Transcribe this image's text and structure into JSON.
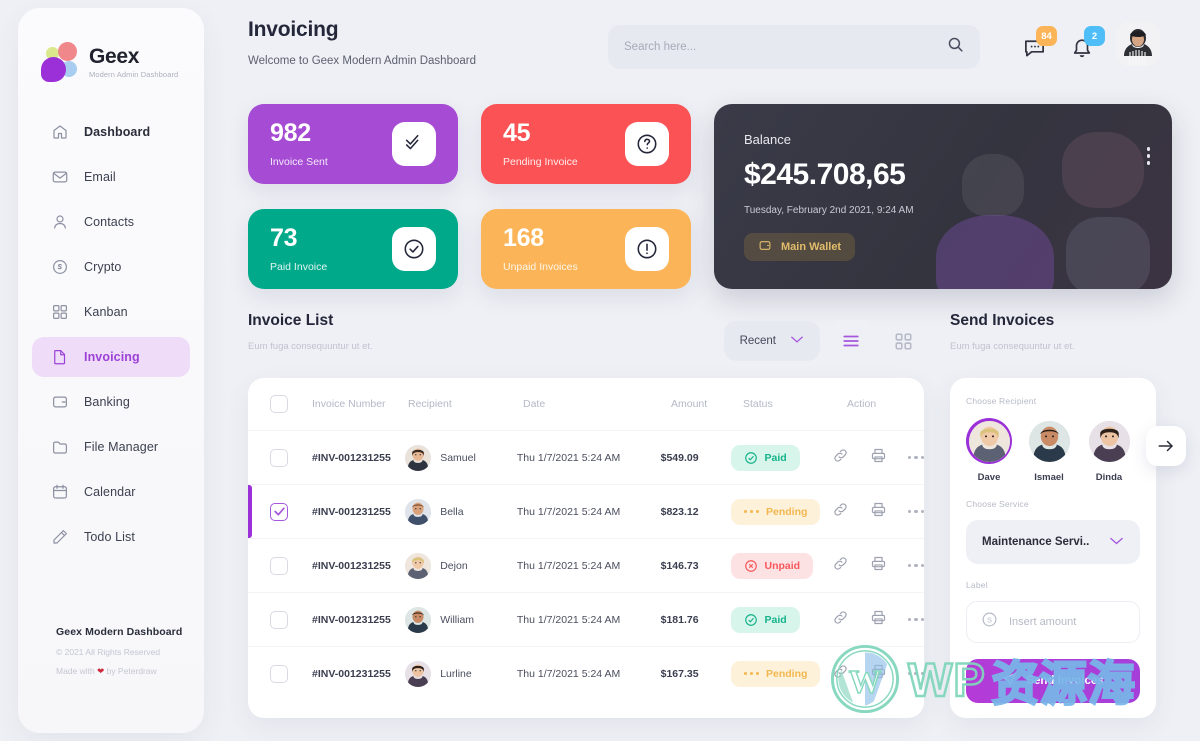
{
  "brand": {
    "name": "Geex",
    "subtitle": "Modern Admin Dashboard"
  },
  "sidebar": {
    "items": [
      {
        "label": "Dashboard",
        "icon": "home-icon",
        "active": false
      },
      {
        "label": "Email",
        "icon": "envelope-icon",
        "active": false
      },
      {
        "label": "Contacts",
        "icon": "user-icon",
        "active": false
      },
      {
        "label": "Crypto",
        "icon": "coin-icon",
        "active": false
      },
      {
        "label": "Kanban",
        "icon": "grid-icon",
        "active": false
      },
      {
        "label": "Invoicing",
        "icon": "file-icon",
        "active": true
      },
      {
        "label": "Banking",
        "icon": "wallet-icon",
        "active": false
      },
      {
        "label": "File Manager",
        "icon": "folder-icon",
        "active": false
      },
      {
        "label": "Calendar",
        "icon": "calendar-icon",
        "active": false
      },
      {
        "label": "Todo List",
        "icon": "pencil-icon",
        "active": false
      }
    ],
    "footer": {
      "title": "Geex Modern Dashboard",
      "copyright": "© 2021 All Rights Reserved",
      "made_prefix": "Made with ",
      "made_suffix": " by Peterdraw"
    }
  },
  "header": {
    "title": "Invoicing",
    "subtitle": "Welcome to Geex Modern Admin Dashboard",
    "search_placeholder": "Search here...",
    "search_value": "",
    "message_badge": "84",
    "notification_badge": "2"
  },
  "stats": [
    {
      "value": "982",
      "label": "Invoice Sent",
      "color": "#a64bd4",
      "icon": "double-check-icon"
    },
    {
      "value": "45",
      "label": "Pending Invoice",
      "color": "#fb5355",
      "icon": "question-circle-icon"
    },
    {
      "value": "73",
      "label": "Paid Invoice",
      "color": "#01a98b",
      "icon": "check-circle-icon"
    },
    {
      "value": "168",
      "label": "Unpaid Invoices",
      "color": "#fbb457",
      "icon": "exclamation-circle-icon"
    }
  ],
  "balance": {
    "label": "Balance",
    "amount": "$245.708,65",
    "date": "Tuesday, February 2nd 2021, 9:24 AM",
    "wallet_label": "Main Wallet"
  },
  "invoice_list": {
    "title": "Invoice List",
    "subtitle": "Eum fuga consequuntur ut et.",
    "sort_label": "Recent",
    "columns": [
      "Invoice Number",
      "Recipient",
      "Date",
      "Amount",
      "Status",
      "Action"
    ],
    "rows": [
      {
        "invoice": "#INV-001231255",
        "recipient": "Samuel",
        "date": "Thu 1/7/2021 5:24 AM",
        "amount": "$549.09",
        "status": "Paid",
        "selected": false
      },
      {
        "invoice": "#INV-001231255",
        "recipient": "Bella",
        "date": "Thu 1/7/2021 5:24 AM",
        "amount": "$823.12",
        "status": "Pending",
        "selected": true
      },
      {
        "invoice": "#INV-001231255",
        "recipient": "Dejon",
        "date": "Thu 1/7/2021 5:24 AM",
        "amount": "$146.73",
        "status": "Unpaid",
        "selected": false
      },
      {
        "invoice": "#INV-001231255",
        "recipient": "William",
        "date": "Thu 1/7/2021 5:24 AM",
        "amount": "$181.76",
        "status": "Paid",
        "selected": false
      },
      {
        "invoice": "#INV-001231255",
        "recipient": "Lurline",
        "date": "Thu 1/7/2021 5:24 AM",
        "amount": "$167.35",
        "status": "Pending",
        "selected": false
      }
    ]
  },
  "send_invoices": {
    "title": "Send Invoices",
    "subtitle": "Eum fuga consequuntur ut et.",
    "recipient_label": "Choose Recipient",
    "recipients": [
      {
        "name": "Dave",
        "selected": true
      },
      {
        "name": "Ismael",
        "selected": false
      },
      {
        "name": "Dinda",
        "selected": false
      }
    ],
    "service_label": "Choose Service",
    "service_value": "Maintenance Servi..",
    "amount_label": "Label",
    "amount_placeholder": "Insert amount",
    "amount_value": "",
    "submit_label": "Send Invoices"
  },
  "watermark": {
    "latin": "WP",
    "chinese": "资源海"
  },
  "colors": {
    "accent": "#9b30d9",
    "purple": "#a64bd4",
    "red": "#fb5355",
    "green": "#01a98b",
    "orange": "#fbb457",
    "paid": "#15b388",
    "pending": "#f3b74f",
    "unpaid": "#f8585c"
  }
}
